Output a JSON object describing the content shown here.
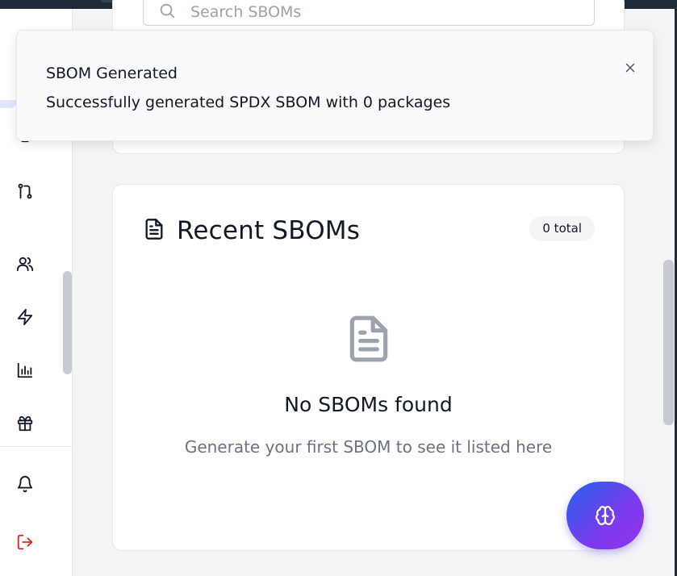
{
  "search": {
    "placeholder": "Search SBOMs"
  },
  "recent": {
    "title": "Recent SBOMs",
    "count_badge": "0 total",
    "empty_title": "No SBOMs found",
    "empty_subtitle": "Generate your first SBOM to see it listed here"
  },
  "toast": {
    "title": "SBOM Generated",
    "message": "Successfully generated SPDX SBOM with 0 packages"
  },
  "sidebar": {
    "icons": [
      "monitor-icon",
      "git-pull-request-icon",
      "users-icon",
      "zap-icon",
      "bar-chart-icon",
      "gift-icon",
      "bell-icon",
      "logout-icon"
    ]
  },
  "colors": {
    "fab_gradient_start": "#2563eb",
    "fab_gradient_end": "#9333ea",
    "logout": "#dc2626",
    "muted": "#6b7280"
  },
  "fab": {
    "icon": "brain-icon"
  }
}
